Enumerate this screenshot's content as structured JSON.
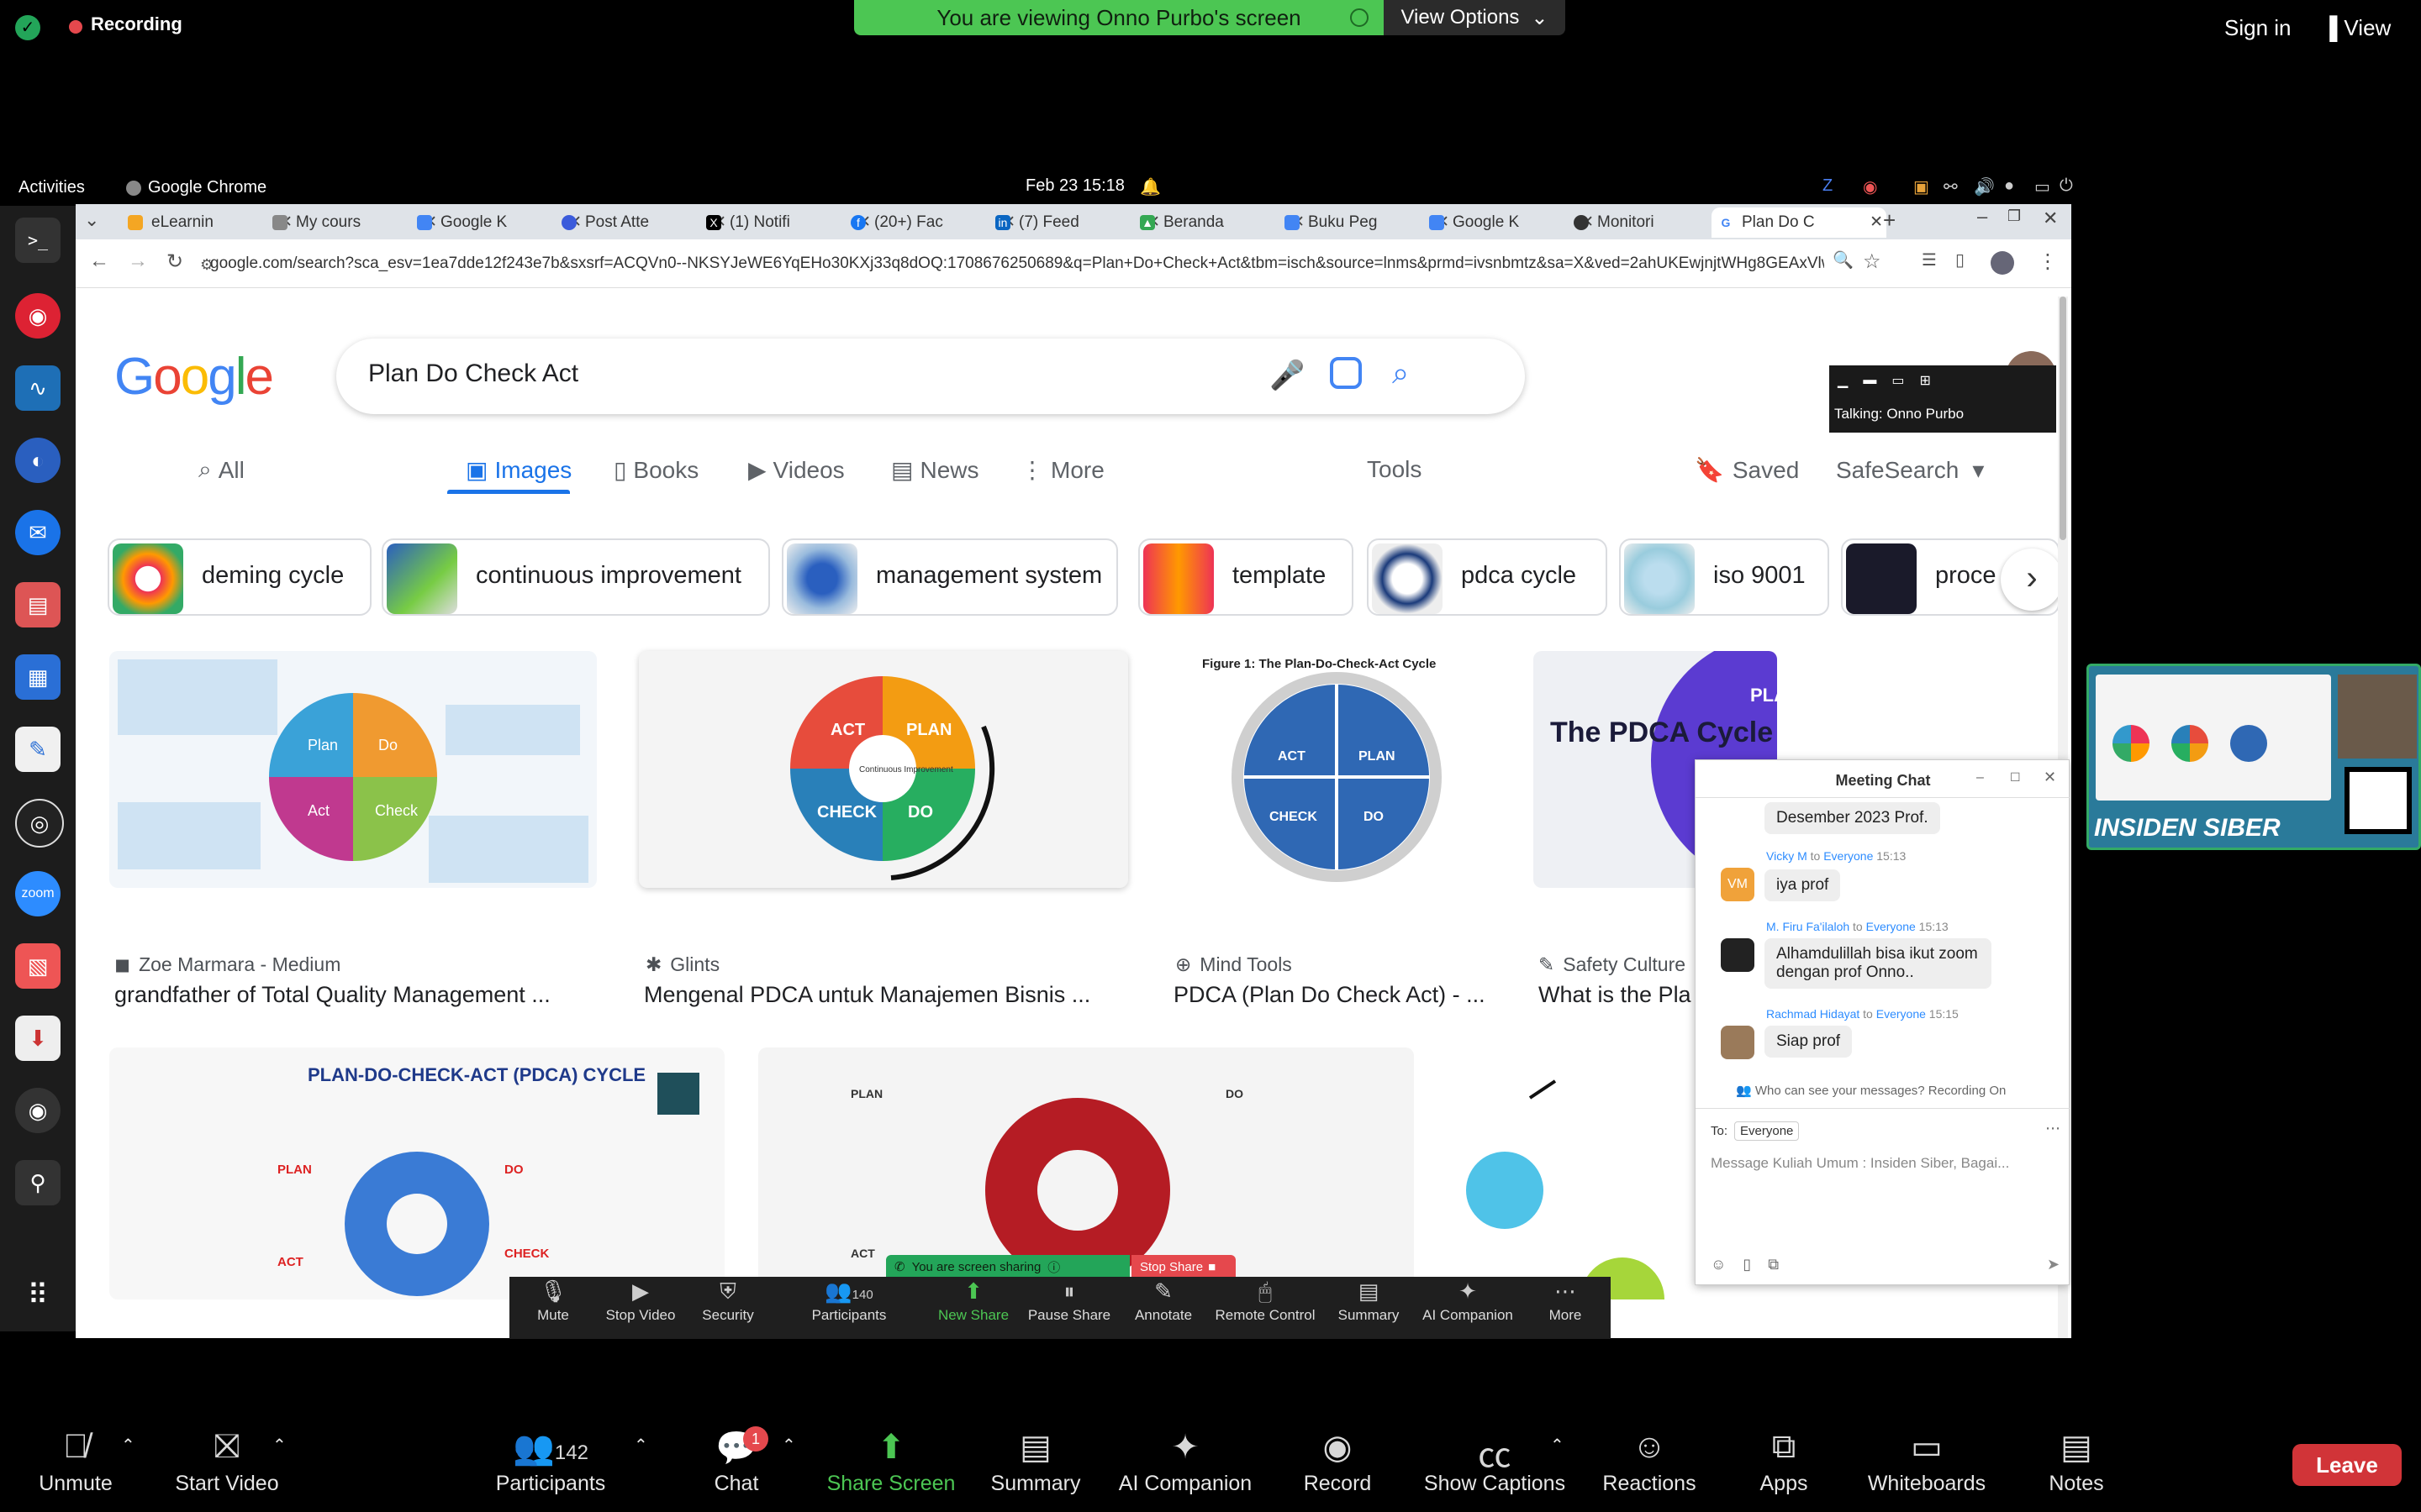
{
  "zoom_top": {
    "recording_label": "Recording",
    "viewing_banner": "You are viewing Onno Purbo's screen",
    "view_options_label": "View Options",
    "sign_in": "Sign in",
    "view": "View"
  },
  "gnome": {
    "activities": "Activities",
    "app_name": "Google Chrome",
    "clock": "Feb 23  15:18"
  },
  "chrome": {
    "tabs": [
      {
        "label": "eLearnin",
        "color": "#f4a623"
      },
      {
        "label": "My cours",
        "color": "#888888"
      },
      {
        "label": "Google K",
        "color": "#4285f4"
      },
      {
        "label": "Post Atte",
        "color": "#3b5bdb"
      },
      {
        "label": "(1) Notifi",
        "color": "#000000"
      },
      {
        "label": "(20+) Fac",
        "color": "#1877f2"
      },
      {
        "label": "(7) Feed",
        "color": "#0a66c2"
      },
      {
        "label": "Beranda",
        "color": "#34a853"
      },
      {
        "label": "Buku Peg",
        "color": "#4285f4"
      },
      {
        "label": "Google K",
        "color": "#4285f4"
      },
      {
        "label": "Monitori",
        "color": "#333333"
      },
      {
        "label": "Plan Do C",
        "color": "#ea4335"
      }
    ],
    "url": "google.com/search?sca_esv=1ea7dde12f243e7b&sxsrf=ACQVn0--NKSYJeWE6YqEHo30KXj33q8dOQ:1708676250689&q=Plan+Do+Check+Act&tbm=isch&source=lnms&prmd=ivsnbmtz&sa=X&ved=2ahUKEwjnjtWHg8GEAxVlwzgGH..."
  },
  "google": {
    "logo": "Google",
    "query": "Plan Do Check Act",
    "talking": "Talking: Onno Purbo",
    "tabs": [
      "All",
      "Images",
      "Books",
      "Videos",
      "News",
      "More"
    ],
    "tools": "Tools",
    "saved": "Saved",
    "safesearch": "SafeSearch",
    "chips": [
      "deming cycle",
      "continuous improvement",
      "management system",
      "template",
      "pdca cycle",
      "iso 9001",
      "proce"
    ],
    "results": [
      {
        "source": "Zoe Marmara - Medium",
        "title": "grandfather of Total Quality Management ..."
      },
      {
        "source": "Glints",
        "title": "Mengenal PDCA untuk Manajemen Bisnis ..."
      },
      {
        "source": "Mind Tools",
        "title": "PDCA (Plan Do Check Act) - ..."
      },
      {
        "source": "Safety Culture",
        "title": "What is the Pla"
      }
    ],
    "img1": {
      "plan": "Plan",
      "do": "Do",
      "act": "Act",
      "check": "Check"
    },
    "img2": {
      "act": "ACT",
      "plan": "PLAN",
      "check": "CHECK",
      "do": "DO",
      "center": "Continuous Improvement"
    },
    "img3": {
      "caption": "Figure 1: The Plan-Do-Check-Act Cycle",
      "act": "ACT",
      "plan": "PLAN",
      "check": "CHECK",
      "do": "DO"
    },
    "img4": {
      "title": "The PDCA Cycle",
      "plan": "PLAN"
    },
    "img5": {
      "title": "PLAN-DO-CHECK-ACT (PDCA) CYCLE",
      "plan": "PLAN",
      "do": "DO",
      "act": "ACT",
      "check": "CHECK"
    },
    "img6": {
      "plan": "PLAN",
      "do": "DO",
      "act": "ACT"
    }
  },
  "chat": {
    "title": "Meeting Chat",
    "top_fragment": "Desember 2023 Prof.",
    "messages": [
      {
        "sender": "Vicky M",
        "to": "to",
        "audience": "Everyone",
        "time": "15:13",
        "initials": "VM",
        "text": "iya prof"
      },
      {
        "sender": "M. Firu Fa'ilaloh",
        "to": "to",
        "audience": "Everyone",
        "time": "15:13",
        "initials": "",
        "text": "Alhamdulillah bisa ikut zoom dengan prof Onno.."
      },
      {
        "sender": "Rachmad Hidayat",
        "to": "to",
        "audience": "Everyone",
        "time": "15:15",
        "initials": "",
        "text": "Siap prof"
      }
    ],
    "visibility": "Who can see your messages? Recording On",
    "to_label": "To:",
    "to_value": "Everyone",
    "placeholder": "Message Kuliah Umum : Insiden Siber, Bagai..."
  },
  "share_toolbar": {
    "status": "You are screen sharing",
    "stop": "Stop Share",
    "participants_count": "140",
    "buttons": [
      "Mute",
      "Stop Video",
      "Security",
      "Participants",
      "New Share",
      "Pause Share",
      "Annotate",
      "Remote Control",
      "Summary",
      "AI Companion",
      "More"
    ]
  },
  "speaker_thumb": {
    "brand": "INSIDEN SIBER"
  },
  "bottom_bar": {
    "participants_count": "142",
    "chat_badge": "1",
    "buttons": [
      "Unmute",
      "Start Video",
      "Participants",
      "Chat",
      "Share Screen",
      "Summary",
      "AI Companion",
      "Record",
      "Show Captions",
      "Reactions",
      "Apps",
      "Whiteboards",
      "Notes"
    ],
    "leave": "Leave"
  }
}
